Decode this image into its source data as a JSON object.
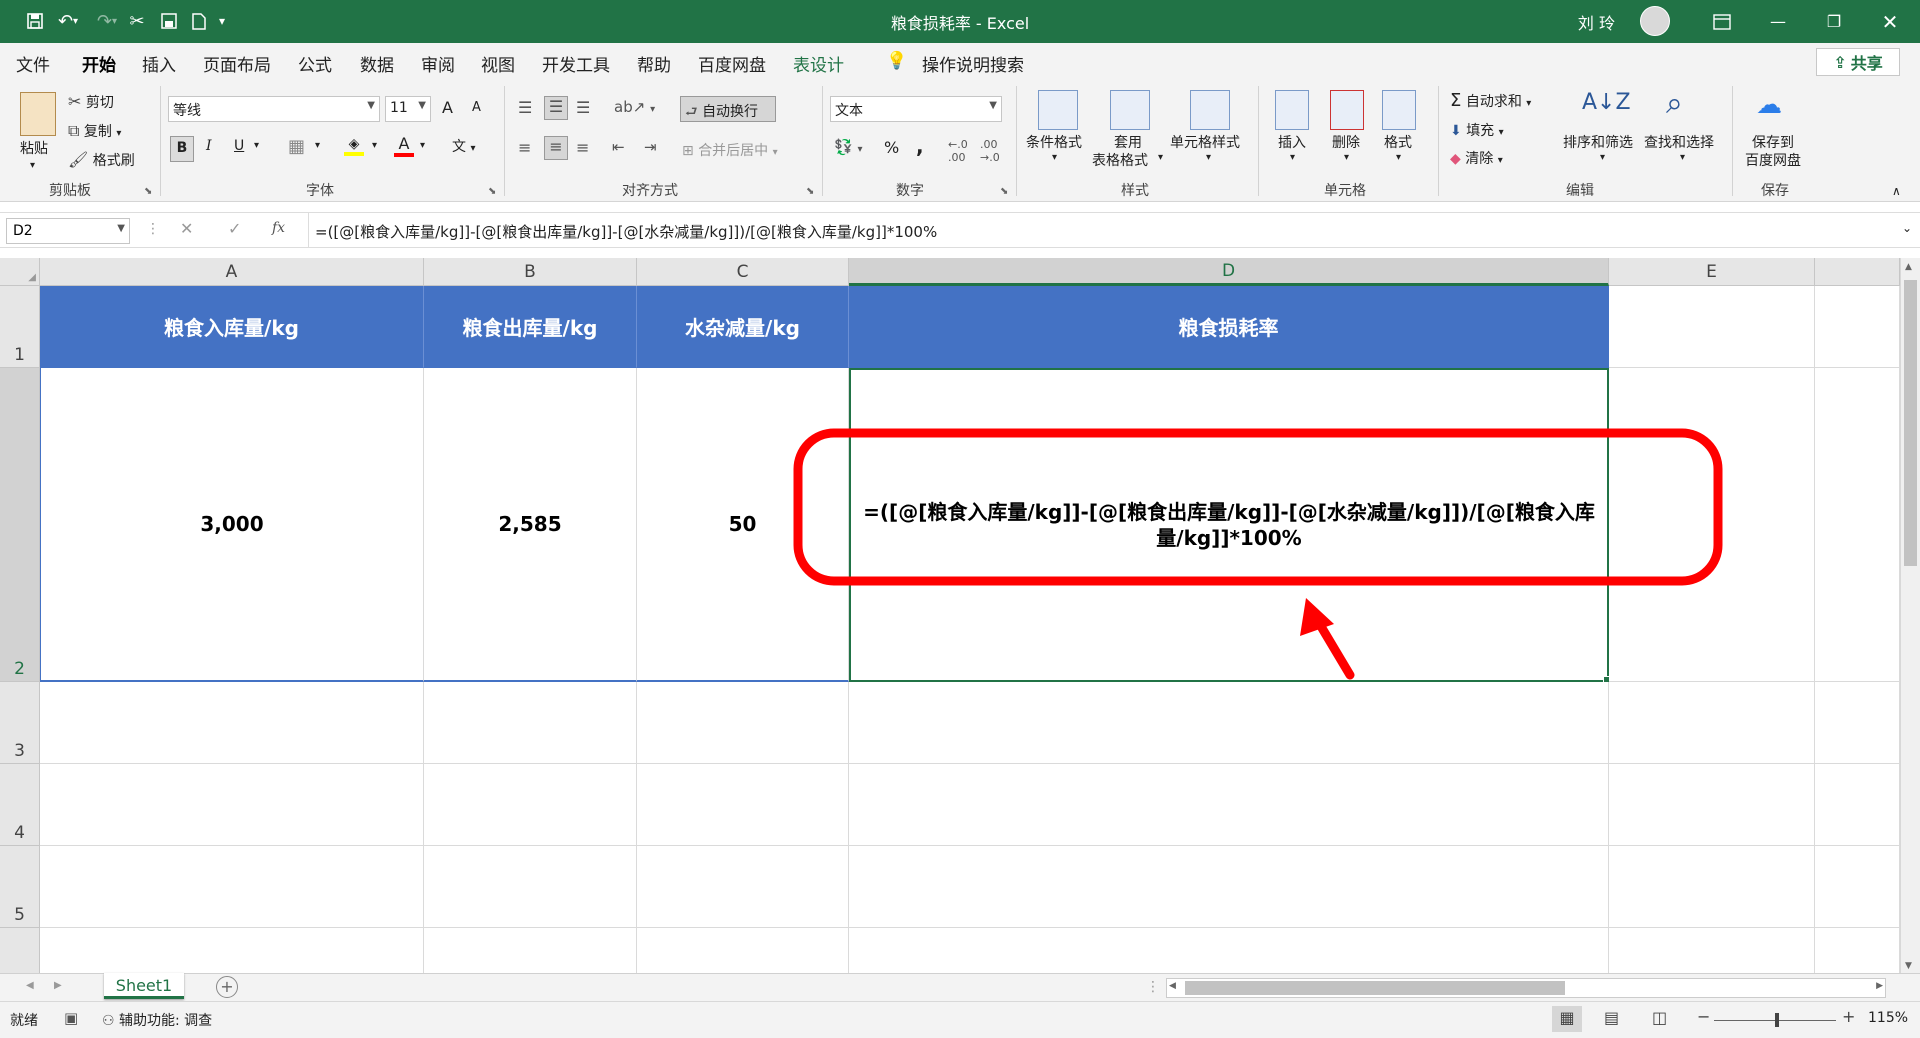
{
  "window": {
    "title": "粮食损耗率 - Excel",
    "user": "刘 玲"
  },
  "tabs": [
    "文件",
    "开始",
    "插入",
    "页面布局",
    "公式",
    "数据",
    "审阅",
    "视图",
    "开发工具",
    "帮助",
    "百度网盘",
    "表设计"
  ],
  "tell_me": "操作说明搜索",
  "share": "共享",
  "ribbon": {
    "clipboard": {
      "paste": "粘贴",
      "cut": "剪切",
      "copy": "复制",
      "format_painter": "格式刷",
      "label": "剪贴板"
    },
    "font": {
      "name": "等线",
      "size": "11",
      "bold": "B",
      "italic": "I",
      "underline": "U",
      "grow": "A",
      "shrink": "A",
      "color_a": "A",
      "wen": "文",
      "label": "字体"
    },
    "alignment": {
      "wrap": "自动换行",
      "merge": "合并后居中",
      "label": "对齐方式"
    },
    "number": {
      "format": "文本",
      "percent": "%",
      "comma": ",",
      "label": "数字"
    },
    "styles": {
      "conditional": "条件格式",
      "table_style_1": "套用",
      "table_style_2": "表格格式",
      "cell_styles": "单元格样式",
      "label": "样式"
    },
    "cells": {
      "insert": "插入",
      "delete": "删除",
      "format": "格式",
      "label": "单元格"
    },
    "editing": {
      "autosum": "自动求和",
      "fill": "填充",
      "clear": "清除",
      "sort": "排序和筛选",
      "find": "查找和选择",
      "label": "编辑"
    },
    "save": {
      "line1": "保存到",
      "line2": "百度网盘",
      "label": "保存"
    }
  },
  "formula_bar": {
    "name_box": "D2",
    "fx": "fx",
    "formula": "=([@[粮食入库量/kg]]-[@[粮食出库量/kg]]-[@[水杂减量/kg]])/[@[粮食入库量/kg]]*100%"
  },
  "columns": [
    "A",
    "B",
    "C",
    "D",
    "E"
  ],
  "rows": [
    "1",
    "2",
    "3",
    "4",
    "5"
  ],
  "table": {
    "headers": [
      "粮食入库量/kg",
      "粮食出库量/kg",
      "水杂减量/kg",
      "粮食损耗率"
    ],
    "row2": [
      "3,000",
      "2,585",
      "50",
      "=([@[粮食入库量/kg]]-[@[粮食出库量/kg]]-[@[水杂减量/kg]])/[@[粮食入库量/kg]]*100%"
    ]
  },
  "sheet_tab": "Sheet1",
  "status": {
    "ready": "就绪",
    "accessibility": "辅助功能: 调查",
    "zoom": "115%"
  },
  "colors": {
    "excel_green": "#217346",
    "table_header": "#4472c4",
    "annotation_red": "#ff0000"
  }
}
